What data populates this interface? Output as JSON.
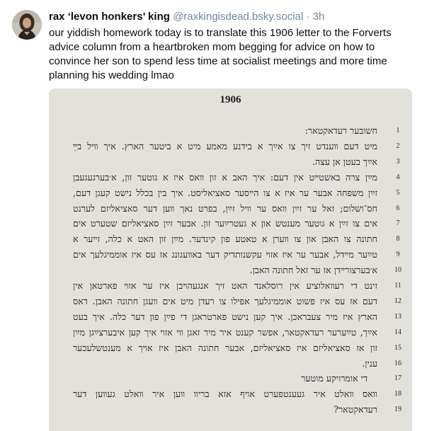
{
  "author": {
    "display_name": "rax ‘levon honkers’ king",
    "handle": "@raxkingisdead.bsky.social",
    "separator": "·",
    "time": "3h"
  },
  "post_text": "our yiddish homework today is to translate this 1906 letter to the Forverts advice column from a heartbroken mom begging for advice on how to convince her son to spend less time at socialist meetings and more time planning his wedding lmao",
  "image": {
    "year": "1906",
    "lines": [
      {
        "num": "1",
        "text": "חשובער רעדאקטאר:"
      },
      {
        "num": "2",
        "text": "מיט דעם װענדט זיך צו אײַך א בידנע מאמע מיט א ביטער הארץ. איך װיל בײַ"
      },
      {
        "num": "3",
        "text": "אײַך בעטן אן עצה."
      },
      {
        "num": "4",
        "text": "מײַן צרה באשטײט אין דעם: איך האב א זון װאס איז א גוטער זון, א׳בערגעגעבן"
      },
      {
        "num": "5",
        "text": "זײַן משפחה אבער ער איז א צו הײסער סאציאליסט. איך בין בכלל נישט קעגן דעם,"
      },
      {
        "num": "6",
        "text": "חס־ושלום; זאל ער זײַן װאס ער װיל זײַן, בפרט נאך װען דער סאציאליזם לערנט"
      },
      {
        "num": "7",
        "text": "אים צו זײַן א גוטער מענטש און א געטרײַער זון. אבער זײַן סאציאליזם שטערט אים"
      },
      {
        "num": "8",
        "text": "חתונה צו האבן און צו װערן א טאטע פון קינדער. מײַן זון האט א כלה, זײער א"
      },
      {
        "num": "9",
        "text": "טײַער מײדל, אבער ער איז אזױ עקשנותדיק דער באװעגונג אז עס איז אוממיגלעך אים"
      },
      {
        "num": "10",
        "text": "א׳בערצורײדן אז ער זאל חתונה האבן."
      },
      {
        "num": "11",
        "text": "זינט די רעװאלוציע אין רוסלאנד האט זיך אנגעהױבן איז ער אזױ פארטאן אין"
      },
      {
        "num": "12",
        "text": "דעם אז עס איז פשוט אוממיגלעך אפילו צו רעדן מיט אים װעגן חתונה האבן. דאס"
      },
      {
        "num": "13",
        "text": "הארץ איז מיר צעבראכן. איך קען נישט פארטראגן די פײַן פון דער כלה. איך בעט"
      },
      {
        "num": "14",
        "text": "אײַך, טײַערער רעדאקטאר, אפשר קענט איר מיר זאגן װי אזױ איך קען איבערצײַגן מײַן"
      },
      {
        "num": "15",
        "text": "זון אז סאציאליזם איז סאציאליזם, אבער חתונה האבן איז אױך א מענטשלעכער"
      },
      {
        "num": "16",
        "text": "ענין."
      },
      {
        "num": "17",
        "text": "די אומרויקע מוטער"
      },
      {
        "num": "18",
        "text": "װאס װאלט איר געענטפערט אויף אזא בריװ װען איר װאלט געװען דער"
      },
      {
        "num": "19",
        "text": "רעדאקטאר?"
      }
    ]
  },
  "colors": {
    "name": "#0b0f14",
    "handle": "#6f869f",
    "paper": "#e3e1dc",
    "ink": "#1f1f1f"
  }
}
